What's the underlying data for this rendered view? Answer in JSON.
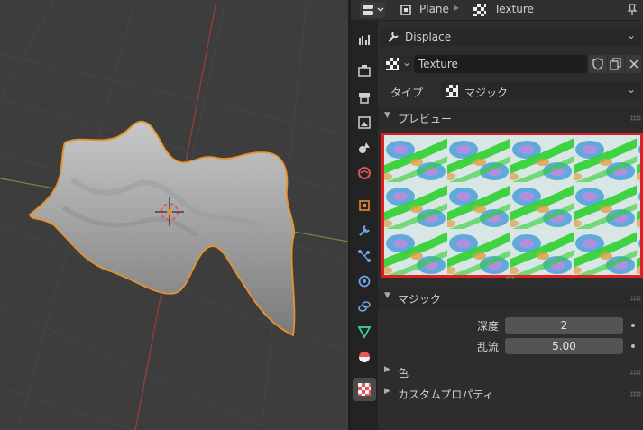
{
  "header": {
    "object": "Plane",
    "texture": "Texture"
  },
  "tabs": [
    {
      "name": "tool-tab-icon",
      "color": "#cfcfcf"
    },
    {
      "name": "render-tab-icon",
      "color": "#cfcfcf"
    },
    {
      "name": "output-tab-icon",
      "color": "#cfcfcf"
    },
    {
      "name": "view-layer-tab-icon",
      "color": "#cfcfcf"
    },
    {
      "name": "scene-tab-icon",
      "color": "#cfcfcf"
    },
    {
      "name": "world-tab-icon",
      "color": "#d55"
    },
    {
      "name": "object-tab-icon",
      "color": "#e88a2e"
    },
    {
      "name": "modifier-tab-icon",
      "color": "#6fa5e6"
    },
    {
      "name": "particles-tab-icon",
      "color": "#6fa5e6"
    },
    {
      "name": "physics-tab-icon",
      "color": "#6fa5e6"
    },
    {
      "name": "constraints-tab-icon",
      "color": "#6fa5e6"
    },
    {
      "name": "data-tab-icon",
      "color": "#3fd6a0"
    },
    {
      "name": "material-tab-icon",
      "color": "#e05a5a"
    },
    {
      "name": "texture-tab-icon",
      "color": "#e05a5a"
    }
  ],
  "props": {
    "context_label": "Displace",
    "texture_name": "Texture",
    "type_label": "タイプ",
    "type_value": "マジック",
    "preview_title": "プレビュー",
    "magic_title": "マジック",
    "depth_label": "深度",
    "depth_value": "2",
    "turbulence_label": "乱流",
    "turbulence_value": "5.00",
    "color_section": "色",
    "custom_props_section": "カスタムプロパティ"
  },
  "colors": {
    "selection_outline": "#e8902a",
    "preview_highlight": "#e02020"
  }
}
